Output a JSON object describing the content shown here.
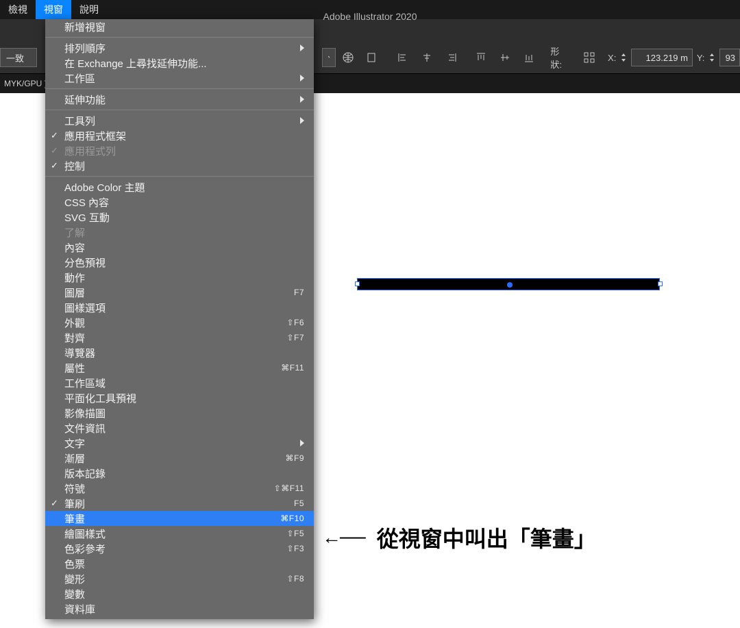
{
  "menubar": {
    "items": [
      {
        "label": "檢視",
        "active": false
      },
      {
        "label": "視窗",
        "active": true
      },
      {
        "label": "說明",
        "active": false
      }
    ]
  },
  "app_title": "Adobe Illustrator 2020",
  "control_bar": {
    "align_label": "一致",
    "shape_label": "形狀:",
    "x_label": "X:",
    "x_value": "123.219 m",
    "y_label": "Y:",
    "y_value": "93"
  },
  "doc_tab": "MYK/GPU )",
  "window_menu": {
    "groups": [
      [
        {
          "label": "新增視窗"
        }
      ],
      [
        {
          "label": "排列順序",
          "submenu": true
        },
        {
          "label": "在 Exchange 上尋找延伸功能..."
        },
        {
          "label": "工作區",
          "submenu": true
        }
      ],
      [
        {
          "label": "延伸功能",
          "submenu": true
        }
      ],
      [
        {
          "label": "工具列",
          "submenu": true
        },
        {
          "label": "應用程式框架",
          "checked": true
        },
        {
          "label": "應用程式列",
          "checked": true,
          "disabled": true
        },
        {
          "label": "控制",
          "checked": true
        }
      ],
      [
        {
          "label": "Adobe Color 主題"
        },
        {
          "label": "CSS 內容"
        },
        {
          "label": "SVG 互動"
        },
        {
          "label": "了解",
          "disabled": true
        },
        {
          "label": "內容"
        },
        {
          "label": "分色預視"
        },
        {
          "label": "動作"
        },
        {
          "label": "圖層",
          "shortcut": "F7"
        },
        {
          "label": "圖樣選項"
        },
        {
          "label": "外觀",
          "shortcut": "⇧F6"
        },
        {
          "label": "對齊",
          "shortcut": "⇧F7"
        },
        {
          "label": "導覽器"
        },
        {
          "label": "屬性",
          "shortcut": "⌘F11"
        },
        {
          "label": "工作區域"
        },
        {
          "label": "平面化工具預視"
        },
        {
          "label": "影像描圖"
        },
        {
          "label": "文件資訊"
        },
        {
          "label": "文字",
          "submenu": true
        },
        {
          "label": "漸層",
          "shortcut": "⌘F9"
        },
        {
          "label": "版本記錄"
        },
        {
          "label": "符號",
          "shortcut": "⇧⌘F11"
        },
        {
          "label": "筆刷",
          "shortcut": "F5",
          "checked": true
        },
        {
          "label": "筆畫",
          "shortcut": "⌘F10",
          "highlight": true
        },
        {
          "label": "繪圖樣式",
          "shortcut": "⇧F5"
        },
        {
          "label": "色彩參考",
          "shortcut": "⇧F3"
        },
        {
          "label": "色票"
        },
        {
          "label": "變形",
          "shortcut": "⇧F8"
        },
        {
          "label": "變數"
        },
        {
          "label": "資料庫"
        }
      ]
    ]
  },
  "annotation": "從視窗中叫出「筆畫」"
}
